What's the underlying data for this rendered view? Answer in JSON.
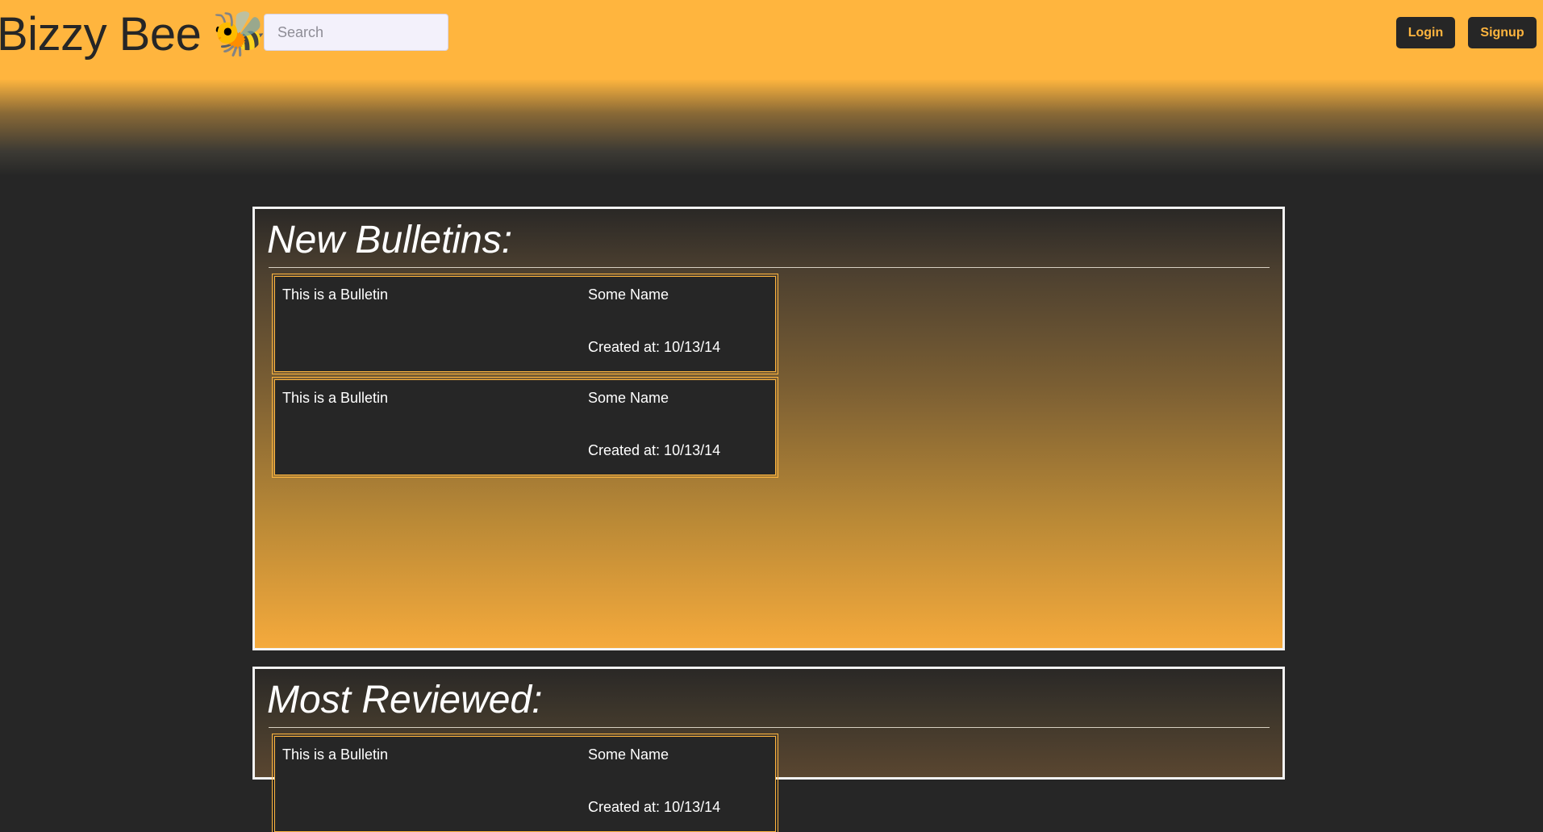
{
  "header": {
    "brand": "Bizzy Bee",
    "brand_emoji": "🐝",
    "search_placeholder": "Search",
    "login_label": "Login",
    "signup_label": "Signup"
  },
  "colors": {
    "accent": "#ffb53e",
    "dark": "#262626",
    "text_light": "#ffffff"
  },
  "sections": [
    {
      "title": "New Bulletins:",
      "bulletins": [
        {
          "title": "This is a Bulletin",
          "author": "Some Name",
          "created": "Created at: 10/13/14"
        },
        {
          "title": "This is a Bulletin",
          "author": "Some Name",
          "created": "Created at: 10/13/14"
        }
      ]
    },
    {
      "title": "Most Reviewed:",
      "bulletins": [
        {
          "title": "This is a Bulletin",
          "author": "Some Name",
          "created": "Created at: 10/13/14"
        }
      ]
    }
  ]
}
